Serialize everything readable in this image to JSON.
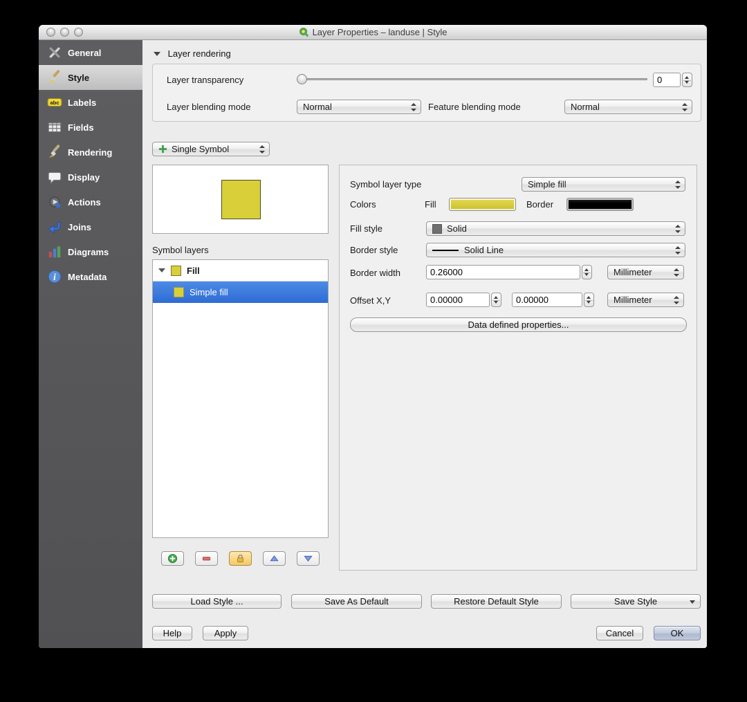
{
  "window": {
    "title": "Layer Properties – landuse | Style"
  },
  "sidebar": {
    "items": [
      {
        "label": "General"
      },
      {
        "label": "Style"
      },
      {
        "label": "Labels"
      },
      {
        "label": "Fields"
      },
      {
        "label": "Rendering"
      },
      {
        "label": "Display"
      },
      {
        "label": "Actions"
      },
      {
        "label": "Joins"
      },
      {
        "label": "Diagrams"
      },
      {
        "label": "Metadata"
      }
    ]
  },
  "rendering": {
    "header": "Layer rendering",
    "transparency_label": "Layer transparency",
    "transparency_value": "0",
    "blend_label": "Layer blending mode",
    "blend_value": "Normal",
    "feature_blend_label": "Feature blending mode",
    "feature_blend_value": "Normal"
  },
  "symbol": {
    "selector": "Single Symbol",
    "layers_label": "Symbol layers",
    "tree_root": "Fill",
    "tree_child": "Simple fill"
  },
  "props": {
    "type_label": "Symbol layer type",
    "type_value": "Simple fill",
    "colors_label": "Colors",
    "fill_label": "Fill",
    "border_label": "Border",
    "fill_style_label": "Fill style",
    "fill_style_value": "Solid",
    "border_style_label": "Border style",
    "border_style_value": "Solid Line",
    "border_width_label": "Border width",
    "border_width_value": "0.26000",
    "border_width_unit": "Millimeter",
    "offset_label": "Offset X,Y",
    "offset_x": "0.00000",
    "offset_y": "0.00000",
    "offset_unit": "Millimeter",
    "data_defined": "Data defined properties..."
  },
  "style_actions": {
    "load": "Load Style ...",
    "save_default": "Save As Default",
    "restore": "Restore Default Style",
    "save": "Save Style"
  },
  "footer": {
    "help": "Help",
    "apply": "Apply",
    "cancel": "Cancel",
    "ok": "OK"
  },
  "colors": {
    "fill": "#d9cf39",
    "fill_gradient_dark": "#c8bd2e",
    "border": "#000000",
    "selection": "#3a78dd"
  }
}
